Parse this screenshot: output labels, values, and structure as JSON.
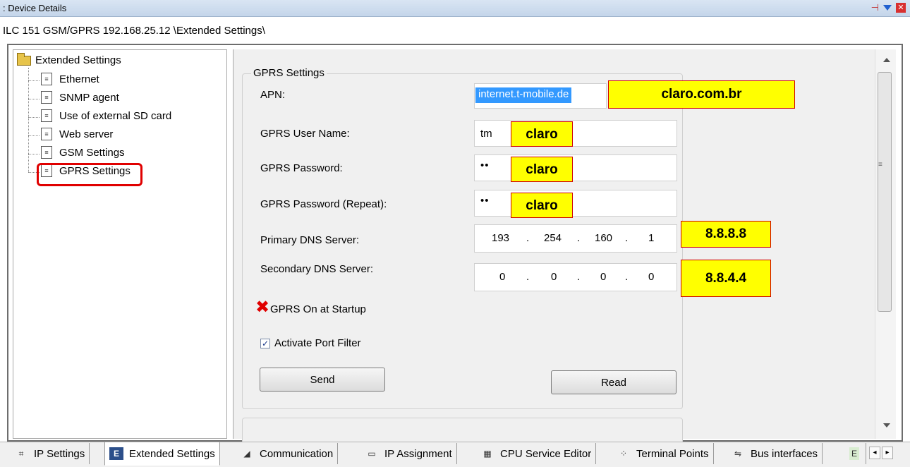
{
  "window": {
    "title": ": Device Details",
    "pin_icon": "pin-icon",
    "dropdown_icon": "dropdown-icon",
    "close_icon": "close-icon"
  },
  "path": "ILC 151 GSM/GPRS 192.168.25.12 \\Extended Settings\\",
  "tree": {
    "root": "Extended Settings",
    "items": [
      "Ethernet",
      "SNMP agent",
      "Use of external SD card",
      "Web server",
      "GSM Settings",
      "GPRS Settings"
    ],
    "selected": "GPRS Settings"
  },
  "group": {
    "title": "GPRS Settings",
    "apn_label": "APN:",
    "apn_value": "internet.t-mobile.de",
    "user_label": "GPRS User Name:",
    "user_value": "tm",
    "password_label": "GPRS Password:",
    "password_value": "••",
    "password_repeat_label": "GPRS Password (Repeat):",
    "password_repeat_value": "••",
    "primary_dns_label": "Primary DNS Server:",
    "primary_dns": [
      "193",
      "254",
      "160",
      "1"
    ],
    "secondary_dns_label": "Secondary DNS Server:",
    "secondary_dns": [
      "0",
      "0",
      "0",
      "0"
    ],
    "dot": ".",
    "startup_label": "GPRS On at Startup",
    "port_filter_label": "Activate Port Filter",
    "port_filter_checked": true,
    "check_mark": "✓",
    "redx_mark": "✖",
    "send_label": "Send",
    "read_label": "Read"
  },
  "annotations": {
    "apn": "claro.com.br",
    "user": "claro",
    "password": "claro",
    "password_repeat": "claro",
    "primary_dns": "8.8.8.8",
    "secondary_dns": "8.8.4.4"
  },
  "tabs": [
    "IP Settings",
    "Extended Settings",
    "Communication",
    "IP Assignment",
    "CPU Service Editor",
    "Terminal Points",
    "Bus interfaces"
  ],
  "active_tab": "Extended Settings",
  "colors": {
    "annotation_fill": "#ffff00",
    "annotation_border": "#d00000",
    "selection": "#3399ff"
  }
}
